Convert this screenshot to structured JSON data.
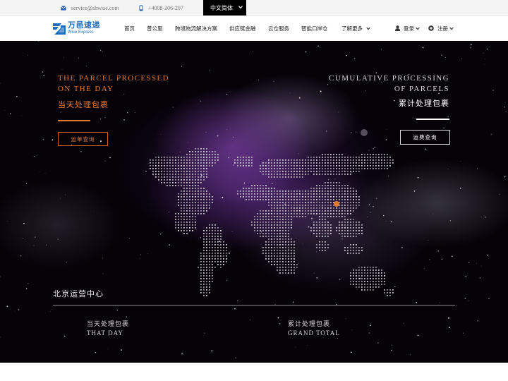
{
  "topbar": {
    "email": "service@shwise.com",
    "phone": "+4008-206-207",
    "language": "中文简体",
    "icons": {
      "email": "envelope-icon",
      "phone": "mobile-phone-icon",
      "language": "caret-down-icon"
    }
  },
  "brand": {
    "name_cn": "万邑速递",
    "name_en": "Wise Express",
    "color": "#1e6fc1"
  },
  "nav": {
    "items": [
      {
        "label": "首页"
      },
      {
        "label": "普公里"
      },
      {
        "label": "跨境物流解决方案"
      },
      {
        "label": "供应链金融"
      },
      {
        "label": "云仓服务"
      },
      {
        "label": "智能口岸仓"
      },
      {
        "label": "了解更多"
      }
    ],
    "login": "登录",
    "register": "注册"
  },
  "hero": {
    "left": {
      "title_line1": "THE PARCEL PROCESSED",
      "title_line2": "ON THE DAY",
      "title_cn": "当天处理包裹",
      "button": "运单查询"
    },
    "right": {
      "title_line1": "CUMULATIVE PROCESSING",
      "title_line2": "OF PARCELS",
      "title_cn": "累计处理包裹",
      "button": "运费查询"
    },
    "center_name": "北京运营中心",
    "stats": [
      {
        "label_cn": "当天处理包裹",
        "label_en": "THAT DAY"
      },
      {
        "label_cn": "累计处理包裹",
        "label_en": "GRAND TOTAL"
      }
    ]
  },
  "colors": {
    "accent": "#e07a35",
    "hero_background": "#050208",
    "nebula": "#8a4fc4",
    "topbar_background": "#f4f4f4",
    "language_background": "#000000"
  }
}
